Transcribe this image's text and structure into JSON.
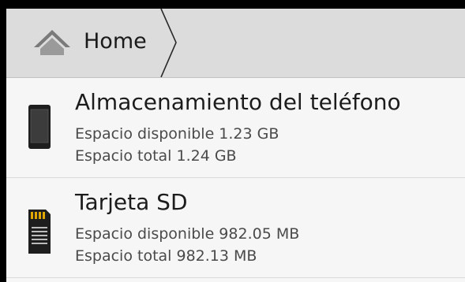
{
  "breadcrumb": {
    "home_label": "Home",
    "home_icon": "home-icon"
  },
  "storage": [
    {
      "title": "Almacenamiento del teléfono",
      "available": "Espacio disponible 1.23 GB",
      "total": "Espacio total 1.24 GB",
      "icon": "phone-icon"
    },
    {
      "title": "Tarjeta SD",
      "available": "Espacio disponible 982.05 MB",
      "total": "Espacio total 982.13 MB",
      "icon": "sd-card-icon"
    }
  ],
  "colors": {
    "header_bg": "#dcdcdc",
    "list_bg": "#f6f6f6",
    "sd_accent": "#e0a800"
  }
}
